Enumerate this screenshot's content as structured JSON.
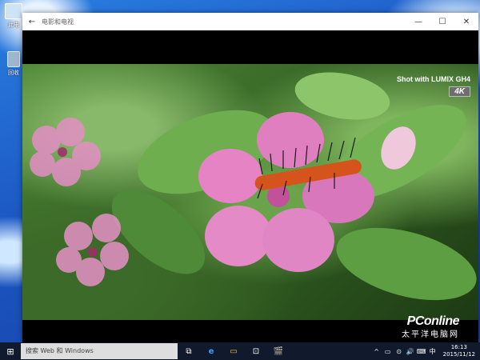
{
  "desktop": {
    "icons": [
      {
        "label": "此电"
      },
      {
        "label": "回收"
      }
    ]
  },
  "window": {
    "title": "电影和电视",
    "back_icon": "←",
    "minimize_icon": "—",
    "maximize_icon": "☐",
    "close_icon": "✕"
  },
  "video": {
    "watermark_text": "Shot with LUMIX GH4",
    "badge": "4K"
  },
  "taskbar": {
    "start_icon": "⊞",
    "search_placeholder": "搜索 Web 和 Windows",
    "icons": [
      "⧉",
      "e",
      "▭",
      "⊡",
      "🎬"
    ],
    "tray_icons": [
      "^",
      "▭",
      "⊙",
      "🔊",
      "⌨",
      "中"
    ],
    "time": "16:13",
    "date": "2015/11/12"
  },
  "watermark_logo": {
    "brand": "PConline",
    "sub": "太平洋电脑网"
  }
}
